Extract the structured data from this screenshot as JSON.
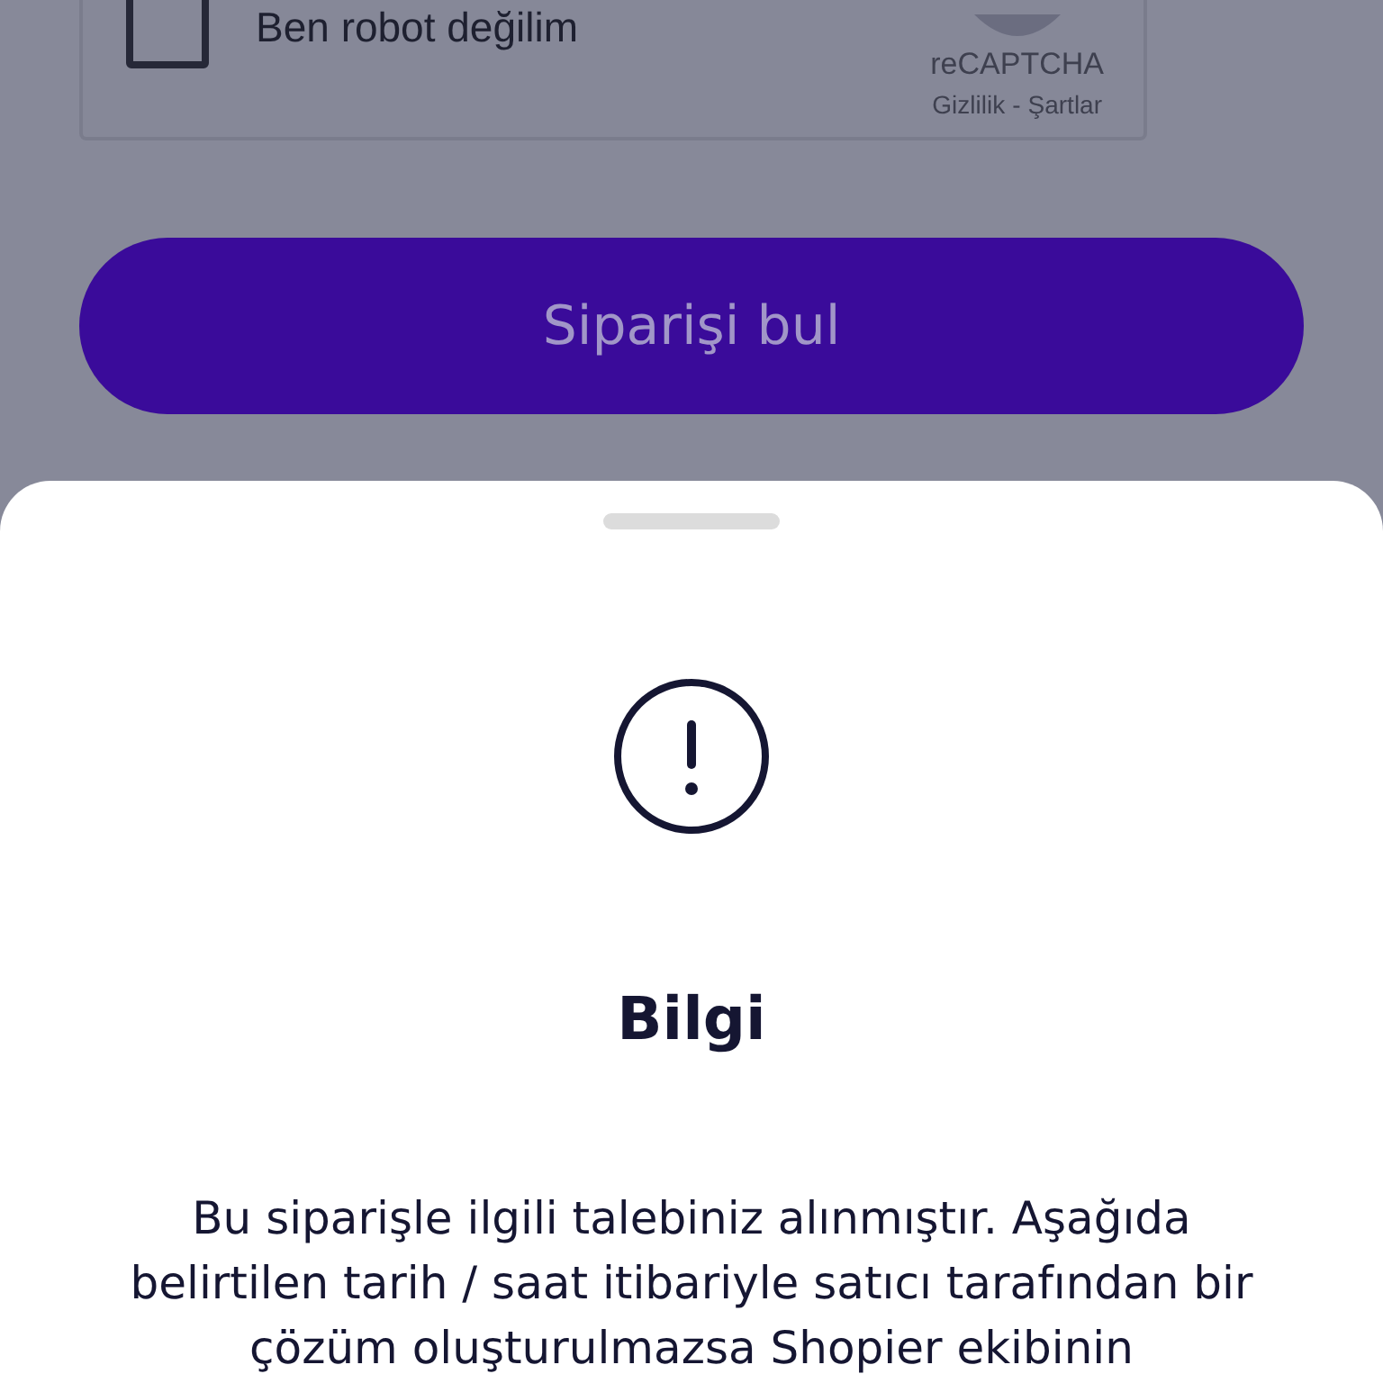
{
  "captcha": {
    "label": "Ben robot değilim",
    "checked": false,
    "brand": "reCAPTCHA",
    "privacy_link": "Gizlilik",
    "separator": "-",
    "terms_link": "Şartlar"
  },
  "submit_button": {
    "label": "Siparişi bul"
  },
  "sheet": {
    "title": "Bilgi",
    "message": "Bu siparişle ilgili talebiniz alınmıştır. Aşağıda belirtilen tarih / saat itibariyle satıcı tarafından bir çözüm oluşturulmazsa Shopier ekibinin"
  }
}
